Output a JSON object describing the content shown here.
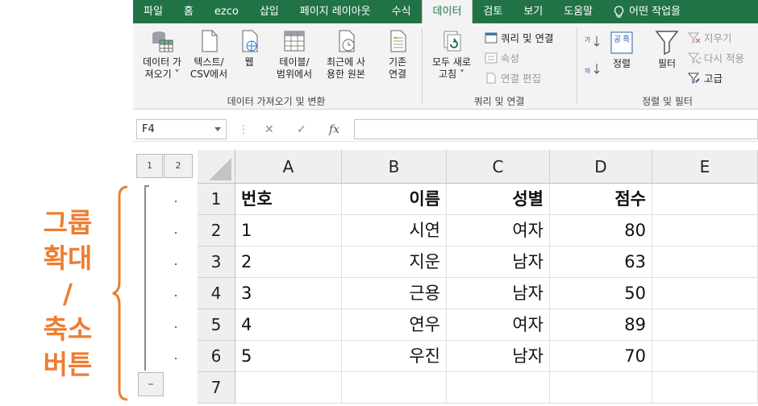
{
  "annotation": {
    "lines": [
      "그룹",
      "확대",
      "/",
      "축소",
      "버튼"
    ],
    "color": "#ed7d31"
  },
  "tabs": [
    {
      "label": "파일"
    },
    {
      "label": "홈"
    },
    {
      "label": "ezco"
    },
    {
      "label": "삽입"
    },
    {
      "label": "페이지 레이아웃"
    },
    {
      "label": "수식"
    },
    {
      "label": "데이터",
      "active": true
    },
    {
      "label": "검토"
    },
    {
      "label": "보기"
    },
    {
      "label": "도움말"
    },
    {
      "label": "어떤 작업을"
    }
  ],
  "ribbon": {
    "get_data": {
      "l1": "데이터 가",
      "l2": "져오기 ˅"
    },
    "text_csv": {
      "l1": "텍스트/",
      "l2": "CSV에서"
    },
    "web": "웹",
    "table_range": {
      "l1": "테이블/",
      "l2": "범위에서"
    },
    "recent": {
      "l1": "최근에 사",
      "l2": "용한 원본"
    },
    "existing": {
      "l1": "기존",
      "l2": "연결"
    },
    "group1": "데이터 가져오기 및 변환",
    "refresh_all": {
      "l1": "모두 새로",
      "l2": "고침 ˅"
    },
    "queries": "쿼리 및 연결",
    "properties": "속성",
    "edit_links": "연결 편집",
    "group2": "쿼리 및 연결",
    "sort": "정렬",
    "filter": "필터",
    "clear": "지우기",
    "reapply": "다시 적용",
    "advanced": "고급",
    "group3": "정렬 및 필터"
  },
  "formula_bar": {
    "name_box": "F4",
    "fx": "fx",
    "cancel": "✕",
    "enter": "✓",
    "value": ""
  },
  "outline": {
    "levels": [
      "1",
      "2"
    ],
    "collapse": "–"
  },
  "columns": [
    "A",
    "B",
    "C",
    "D",
    "E"
  ],
  "rows": [
    {
      "num": "1",
      "a": "번호",
      "b": "이름",
      "c": "성별",
      "d": "점수"
    },
    {
      "num": "2",
      "a": "1",
      "b": "시연",
      "c": "여자",
      "d": "80"
    },
    {
      "num": "3",
      "a": "2",
      "b": "지운",
      "c": "남자",
      "d": "63"
    },
    {
      "num": "4",
      "a": "3",
      "b": "근용",
      "c": "남자",
      "d": "50"
    },
    {
      "num": "5",
      "a": "4",
      "b": "연우",
      "c": "여자",
      "d": "89"
    },
    {
      "num": "6",
      "a": "5",
      "b": "우진",
      "c": "남자",
      "d": "70"
    },
    {
      "num": "7",
      "a": "",
      "b": "",
      "c": "",
      "d": ""
    }
  ]
}
